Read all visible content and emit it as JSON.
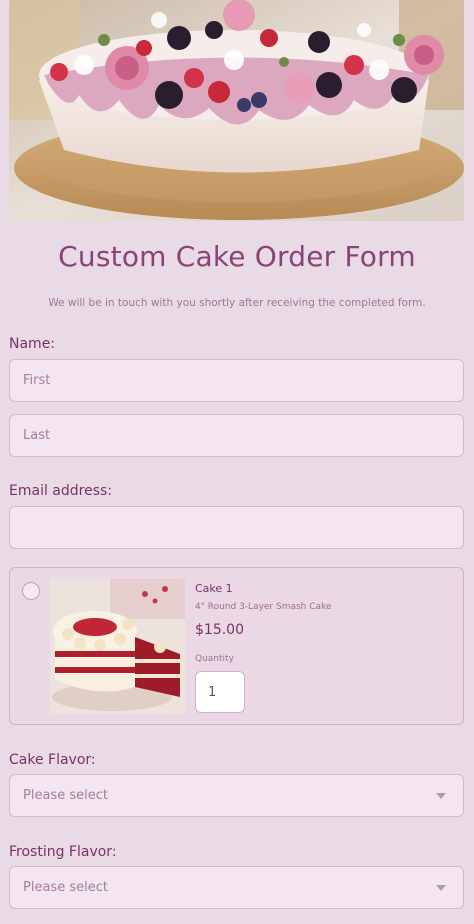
{
  "header": {
    "title": "Custom Cake Order Form",
    "subtitle": "We will be in touch with you shortly after receiving the completed form."
  },
  "name_field": {
    "label": "Name:",
    "first_placeholder": "First",
    "last_placeholder": "Last"
  },
  "email_field": {
    "label": "Email address:",
    "value": ""
  },
  "product": {
    "name": "Cake 1",
    "description": "4\" Round 3-Layer Smash Cake",
    "price": "$15.00",
    "quantity_label": "Quantity",
    "quantity_value": "1",
    "selected": false
  },
  "cake_flavor": {
    "label": "Cake Flavor:",
    "selected": "Please select"
  },
  "frosting_flavor": {
    "label": "Frosting Flavor:",
    "selected": "Please select"
  },
  "colors": {
    "background": "#e9dbe6",
    "accent": "#8a4379",
    "input_bg": "#f3e6f0",
    "input_border": "#d9b6cf"
  },
  "icons": {
    "select_arrow": "chevron-down-icon",
    "product_radio": "radio-icon"
  }
}
